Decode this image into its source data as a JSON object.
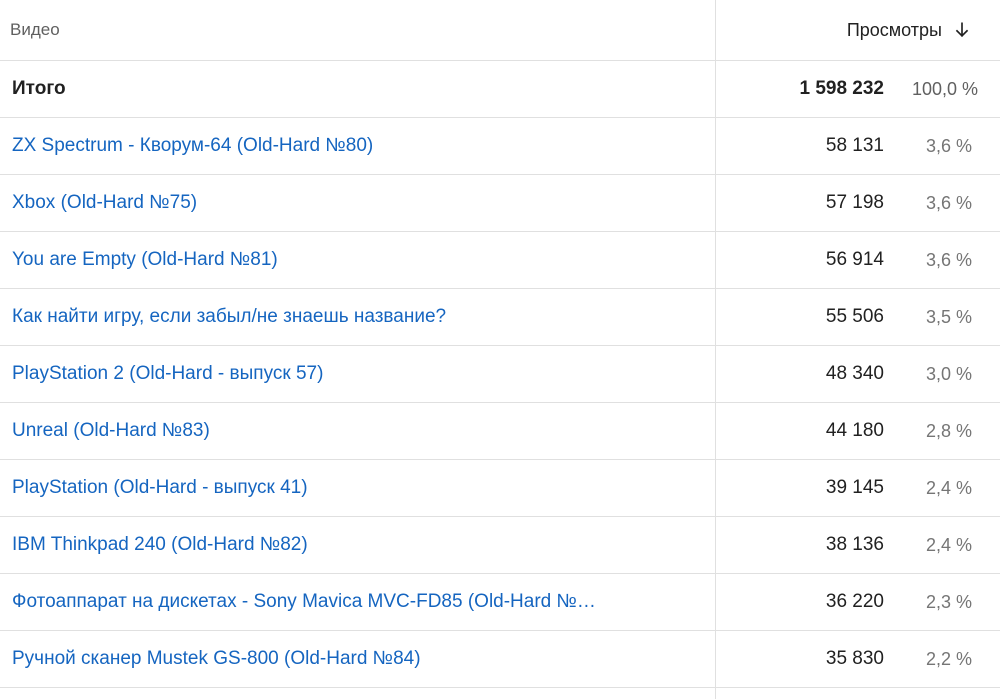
{
  "header": {
    "video_col": "Видео",
    "views_col": "Просмотры",
    "sort_icon": "arrow-down-icon"
  },
  "total": {
    "label": "Итого",
    "views": "1 598 232",
    "percent": "100,0 %"
  },
  "rows": [
    {
      "title": "ZX Spectrum - Кворум-64 (Old-Hard №80)",
      "views": "58 131",
      "percent": "3,6 %"
    },
    {
      "title": "Xbox (Old-Hard №75)",
      "views": "57 198",
      "percent": "3,6 %"
    },
    {
      "title": "You are Empty (Old-Hard №81)",
      "views": "56 914",
      "percent": "3,6 %"
    },
    {
      "title": "Как найти игру, если забыл/не знаешь название?",
      "views": "55 506",
      "percent": "3,5 %"
    },
    {
      "title": "PlayStation 2 (Old-Hard - выпуск 57)",
      "views": "48 340",
      "percent": "3,0 %"
    },
    {
      "title": "Unreal (Old-Hard №83)",
      "views": "44 180",
      "percent": "2,8 %"
    },
    {
      "title": "PlayStation (Old-Hard - выпуск 41)",
      "views": "39 145",
      "percent": "2,4 %"
    },
    {
      "title": "IBM Thinkpad 240 (Old-Hard №82)",
      "views": "38 136",
      "percent": "2,4 %"
    },
    {
      "title": "Фотоаппарат на дискетах - Sony Mavica MVC-FD85 (Old-Hard №…",
      "views": "36 220",
      "percent": "2,3 %"
    },
    {
      "title": "Ручной сканер Mustek GS-800 (Old-Hard №84)",
      "views": "35 830",
      "percent": "2,2 %"
    }
  ],
  "colors": {
    "link": "#1565c0",
    "divider": "#e0e0e0",
    "muted": "#757575"
  }
}
